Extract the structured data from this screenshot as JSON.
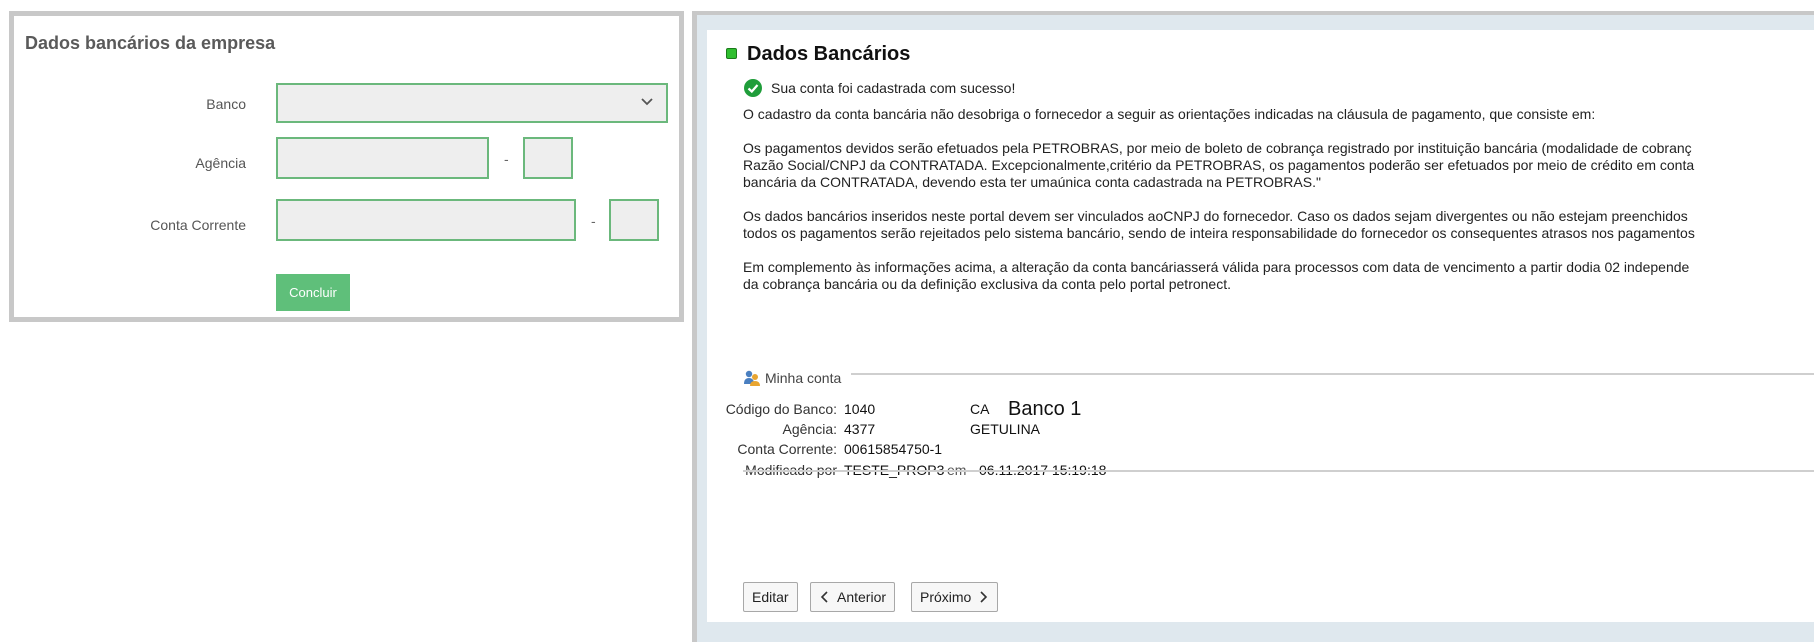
{
  "left_form": {
    "title": "Dados bancários da empresa",
    "labels": {
      "banco": "Banco",
      "agencia": "Agência",
      "conta": "Conta Corrente"
    },
    "dash": "-",
    "submit": "Concluir"
  },
  "right": {
    "title": "Dados Bancários",
    "success": "Sua conta foi cadastrada com sucesso!",
    "paragraphs": [
      "O cadastro da conta bancária não desobriga o fornecedor a seguir as orientações indicadas na cláusula de pagamento, que consiste em:",
      "Os pagamentos devidos serão efetuados pela PETROBRAS, por meio de boleto de cobrança registrado por instituição bancária (modalidade de cobranç",
      "Razão Social/CNPJ da CONTRATADA. Excepcionalmente,critério da PETROBRAS, os pagamentos poderão ser efetuados por meio de crédito em conta",
      "bancária da CONTRATADA, devendo esta ter umaúnica conta cadastrada na PETROBRAS.\"",
      "Os dados bancários inseridos neste portal devem ser vinculados aoCNPJ do fornecedor. Caso os dados sejam divergentes ou não estejam preenchidos",
      "todos os pagamentos serão rejeitados pelo sistema bancário, sendo de inteira responsabilidade do fornecedor os consequentes atrasos nos pagamentos",
      "Em complemento às informações acima, a alteração da conta bancáriasserá válida para processos com data de vencimento a partir dodia 02 independe",
      "da cobrança bancária ou da definição exclusiva da conta pelo portal petronect."
    ],
    "account": {
      "section_title": "Minha conta",
      "codigo_label": "Código do Banco:",
      "codigo_value": "1040",
      "codigo_extra": "CA",
      "agencia_label": "Agência:",
      "agencia_value": "4377",
      "agencia_extra": "GETULINA",
      "conta_label": "Conta Corrente:",
      "conta_value": "00615854750-1",
      "modificado_label": "Modificado por",
      "modificado_value": "TESTE_PROP3",
      "em_label": "em",
      "date_value": "06.11.2017 15:19:18"
    },
    "overlay": "Banco 1",
    "buttons": {
      "edit": "Editar",
      "prev": "Anterior",
      "next": "Próximo"
    }
  },
  "colors": {
    "accent_green": "#5fbf7a",
    "input_border": "#6bb87c",
    "frame_bg": "#dfe8ee"
  }
}
